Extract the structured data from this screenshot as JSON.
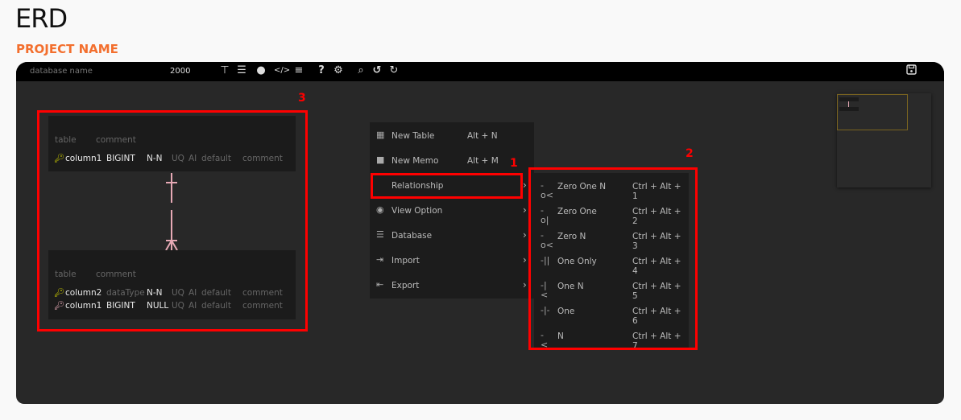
{
  "page": {
    "title": "ERD",
    "project_name": "PROJECT NAME"
  },
  "toolbar": {
    "database_name": "database name",
    "canvas_size": "2000",
    "icons": [
      "relationship-tree-icon",
      "list-icon",
      "shapes-icon",
      "code-icon",
      "sliders-icon",
      "help-icon",
      "gear-icon",
      "search-icon",
      "undo-icon",
      "redo-icon",
      "save-icon"
    ]
  },
  "tables": [
    {
      "name": "table",
      "comment": "comment",
      "columns": [
        {
          "key": "primary",
          "name": "column1",
          "type": "BIGINT",
          "nullable": "N-N",
          "uq": "UQ",
          "ai": "AI",
          "default": "default",
          "comment": "comment"
        }
      ]
    },
    {
      "name": "table",
      "comment": "comment",
      "columns": [
        {
          "key": "primary",
          "name": "column2",
          "type": "dataType",
          "nullable": "N-N",
          "uq": "UQ",
          "ai": "AI",
          "default": "default",
          "comment": "comment"
        },
        {
          "key": "foreign",
          "name": "column1",
          "type": "BIGINT",
          "nullable": "NULL",
          "uq": "UQ",
          "ai": "AI",
          "default": "default",
          "comment": "comment"
        }
      ]
    }
  ],
  "relationship_color": "#e6a9b5",
  "context_menu": {
    "items": [
      {
        "label": "New Table",
        "shortcut": "Alt + N",
        "icon": "table-icon"
      },
      {
        "label": "New Memo",
        "shortcut": "Alt + M",
        "icon": "memo-icon"
      },
      {
        "label": "Relationship",
        "shortcut": "",
        "icon": "",
        "submenu": true
      },
      {
        "label": "View Option",
        "shortcut": "",
        "icon": "eye-icon",
        "submenu": true
      },
      {
        "label": "Database",
        "shortcut": "",
        "icon": "database-icon",
        "submenu": true
      },
      {
        "label": "Import",
        "shortcut": "",
        "icon": "import-icon",
        "submenu": true
      },
      {
        "label": "Export",
        "shortcut": "",
        "icon": "export-icon",
        "submenu": true
      }
    ]
  },
  "relationship_menu": {
    "items": [
      {
        "label": "Zero One N",
        "shortcut": "Ctrl + Alt + 1"
      },
      {
        "label": "Zero One",
        "shortcut": "Ctrl + Alt + 2"
      },
      {
        "label": "Zero N",
        "shortcut": "Ctrl + Alt + 3"
      },
      {
        "label": "One Only",
        "shortcut": "Ctrl + Alt + 4"
      },
      {
        "label": "One N",
        "shortcut": "Ctrl + Alt + 5"
      },
      {
        "label": "One",
        "shortcut": "Ctrl + Alt + 6"
      },
      {
        "label": "N",
        "shortcut": "Ctrl + Alt + 7"
      }
    ]
  },
  "annotations": {
    "label1": "1",
    "label2": "2",
    "label3": "3",
    "color": "#ff0000"
  }
}
